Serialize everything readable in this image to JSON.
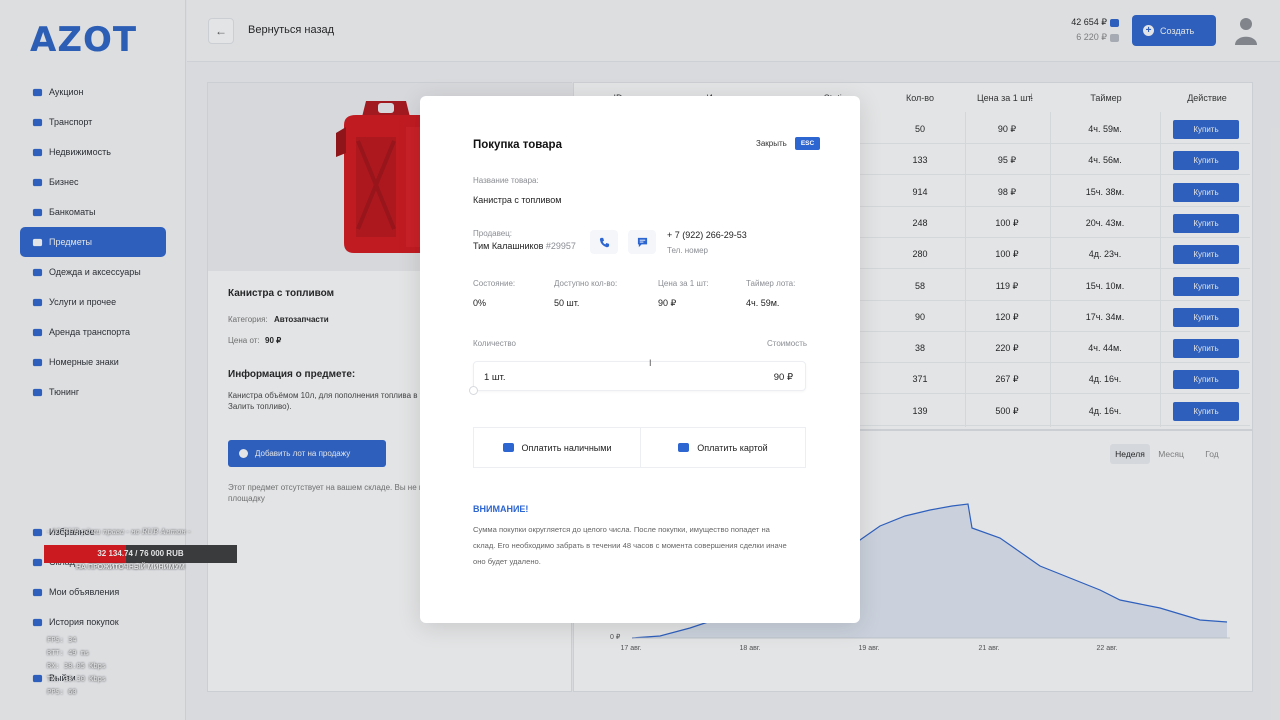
{
  "logo": "AZOT",
  "sidebar": {
    "items": [
      {
        "label": "Аукцион",
        "icon": "auction-icon"
      },
      {
        "label": "Транспорт",
        "icon": "car-icon"
      },
      {
        "label": "Недвижимость",
        "icon": "house-icon"
      },
      {
        "label": "Бизнес",
        "icon": "business-icon"
      },
      {
        "label": "Банкоматы",
        "icon": "atm-icon"
      },
      {
        "label": "Предметы",
        "icon": "box-icon",
        "active": true
      },
      {
        "label": "Одежда и аксессуары",
        "icon": "clothes-icon"
      },
      {
        "label": "Услуги и прочее",
        "icon": "services-icon"
      },
      {
        "label": "Аренда транспорта",
        "icon": "rent-icon"
      },
      {
        "label": "Номерные знаки",
        "icon": "plate-icon"
      },
      {
        "label": "Тюнинг",
        "icon": "tuning-icon"
      }
    ],
    "bottom_items": [
      {
        "label": "Избранное",
        "icon": "heart-icon"
      },
      {
        "label": "Склад",
        "icon": "warehouse-icon"
      },
      {
        "label": "Мои объявления",
        "icon": "ads-icon"
      },
      {
        "label": "История покупок",
        "icon": "history-icon"
      },
      {
        "label": "Выйти",
        "icon": "logout-icon"
      }
    ]
  },
  "header": {
    "back_label": "Вернуться назад",
    "balance_main": "42 654 ₽",
    "balance_secondary": "6 220 ₽",
    "create_label": "Создать"
  },
  "product": {
    "name": "Канистра с топливом",
    "category_label": "Категория:",
    "category_value": "Автозапчасти",
    "price_label": "Цена от:",
    "price_value": "90 ₽",
    "info_title": "Информация о предмете:",
    "info_text": "Канистра объёмом 10л, для пополнения топлива в т",
    "info_text2": "Залить топливо).",
    "add_lot_label": "Добавить лот на продажу",
    "warehouse_note": "Этот предмет отсутствует на вашем складе. Вы не м",
    "warehouse_note2": "площадку"
  },
  "table": {
    "headers": [
      "ID",
      "Имя игрока",
      "Statis",
      "Кол-во",
      "Цена за 1 шт.",
      "Таймер",
      "Действие"
    ],
    "buy_label": "Купить",
    "rows": [
      {
        "qty": "50",
        "price": "90 ₽",
        "timer": "4ч. 59м."
      },
      {
        "qty": "133",
        "price": "95 ₽",
        "timer": "4ч. 56м."
      },
      {
        "qty": "914",
        "price": "98 ₽",
        "timer": "15ч. 38м."
      },
      {
        "qty": "248",
        "price": "100 ₽",
        "timer": "20ч. 43м."
      },
      {
        "qty": "280",
        "price": "100 ₽",
        "timer": "4д. 23ч."
      },
      {
        "qty": "58",
        "price": "119 ₽",
        "timer": "15ч. 10м."
      },
      {
        "qty": "90",
        "price": "120 ₽",
        "timer": "17ч. 34м."
      },
      {
        "qty": "38",
        "price": "220 ₽",
        "timer": "4ч. 44м."
      },
      {
        "qty": "371",
        "price": "267 ₽",
        "timer": "4д. 16ч."
      },
      {
        "qty": "139",
        "price": "500 ₽",
        "timer": "4д. 16ч."
      }
    ]
  },
  "chart": {
    "periods": [
      "Неделя",
      "Месяц",
      "Год"
    ],
    "active_period": "Неделя",
    "y_zero": "0 ₽",
    "x_labels": [
      "17 авг.",
      "18 авг.",
      "19 авг.",
      "21 авг.",
      "22 авг."
    ]
  },
  "modal": {
    "title": "Покупка товара",
    "close_label": "Закрыть",
    "esc_label": "ESC",
    "item_name_label": "Название товара:",
    "item_name": "Канистра с топливом",
    "seller_label": "Продавец:",
    "seller_name": "Тим Калашников",
    "seller_id": "#29957",
    "phone": "+ 7 (922) 266-29-53",
    "phone_label": "Тел. номер",
    "state_label": "Состояние:",
    "state_value": "0%",
    "available_label": "Доступно кол-во:",
    "available_value": "50 шт.",
    "unit_price_label": "Цена за 1 шт:",
    "unit_price_value": "90 ₽",
    "timer_label": "Таймер лота:",
    "timer_value": "4ч. 59м.",
    "quantity_label": "Количество",
    "cost_label": "Стоимость",
    "quantity_value": "1 шт.",
    "cost_value": "90 ₽",
    "pay_cash_label": "Оплатить наличными",
    "pay_card_label": "Оплатить картой",
    "warning_title": "ВНИМАНИЕ!",
    "warning_text_1": "Сумма покупки округляется до целого числа. После покупки, имущество попадет на",
    "warning_text_2": "склад. Его необходимо забрать в течении 48 часов с момента совершения сделки иначе",
    "warning_text_3": "оно будет удалено."
  },
  "hud": {
    "top_line": "- 10 RUB    рдми права - но RUB    Антон -",
    "progress_text": "32 134.74 / 76 000 RUB",
    "progress_fraction": 0.4228,
    "subsistence": "НА ПРОЖИТОЧНЫЙ МИНИМУМ",
    "stats": [
      "FPS:  34",
      "RTT:  49 ms",
      "RX:   38.05 Kbps",
      "TX:   38.30 Kbps",
      "PPS:  60"
    ]
  },
  "colors": {
    "accent": "#2d65d1",
    "hud_red": "#e3151a"
  }
}
